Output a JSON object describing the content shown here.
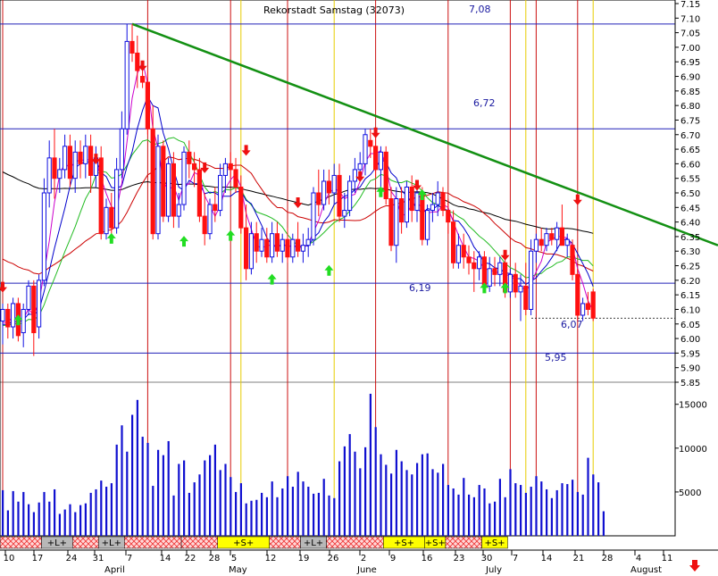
{
  "title_overlay": "Rekorstadt Samstag (32073)",
  "colors": {
    "up": "#1010e0",
    "down": "#ff1010",
    "trend": "#139013",
    "level": "#2020b8",
    "signal_sell": "#cc1010",
    "signal_buy": "#e6cc00",
    "ma_black": "#000000",
    "ma_red": "#cc0000",
    "ma_green": "#22bb22",
    "ma_blue": "#0000cc",
    "ma_magenta": "#cc00cc",
    "buy_arrow": "#22dd22",
    "sell_arrow": "#ee1010",
    "volume": "#1010d0",
    "band_L": "#b8b8b8",
    "band_S": "#ffff00",
    "band_hatch": "#ee3333"
  },
  "chart_data": {
    "type": "candlestick",
    "y_axis": {
      "min": 5.85,
      "max": 7.15,
      "ticks": [
        "7.15",
        "7.10",
        "7.05",
        "7.00",
        "6.95",
        "6.90",
        "6.85",
        "6.80",
        "6.75",
        "6.70",
        "6.65",
        "6.60",
        "6.55",
        "6.50",
        "6.45",
        "6.40",
        "6.35",
        "6.30",
        "6.25",
        "6.20",
        "6.15",
        "6.10",
        "6.05",
        "6.00",
        "5.95",
        "5.90",
        "5.85"
      ]
    },
    "volume_axis": {
      "ticks": [
        "15000",
        "10000",
        "5000"
      ],
      "max": 16500
    },
    "x_ticks": [
      "10",
      "17",
      "24",
      "31",
      "7",
      "14",
      "22",
      "28",
      "5",
      "12",
      "19",
      "26",
      "2",
      "9",
      "16",
      "23",
      "30",
      "7",
      "14",
      "21",
      "28",
      "4",
      "11"
    ],
    "month_labels": [
      "April",
      "May",
      "June",
      "July",
      "August"
    ],
    "levels": [
      {
        "value": 7.08,
        "label": "7,08"
      },
      {
        "value": 6.72,
        "label": "6,72"
      },
      {
        "value": 6.19,
        "label": "6,19"
      },
      {
        "value": 6.07,
        "label": "6,07"
      },
      {
        "value": 5.95,
        "label": "5,95"
      }
    ],
    "trendline": {
      "start": {
        "day": 25,
        "value": 7.08
      },
      "end": {
        "day": 130,
        "value": 6.32
      }
    },
    "sell_signal_days": [
      0,
      28,
      44,
      55,
      72,
      86,
      98,
      103,
      111
    ],
    "buy_signal_days": [
      46,
      64,
      101,
      114
    ],
    "candles": [
      {
        "o": 6.06,
        "h": 6.12,
        "l": 5.98,
        "c": 6.1
      },
      {
        "o": 6.1,
        "h": 6.12,
        "l": 6.0,
        "c": 6.04
      },
      {
        "o": 6.04,
        "h": 6.14,
        "l": 6.0,
        "c": 6.12
      },
      {
        "o": 6.12,
        "h": 6.14,
        "l": 5.99,
        "c": 6.01
      },
      {
        "o": 6.02,
        "h": 6.12,
        "l": 5.97,
        "c": 6.1
      },
      {
        "o": 6.1,
        "h": 6.2,
        "l": 6.08,
        "c": 6.18
      },
      {
        "o": 6.18,
        "h": 6.2,
        "l": 5.94,
        "c": 6.02
      },
      {
        "o": 6.04,
        "h": 6.22,
        "l": 6.0,
        "c": 6.2
      },
      {
        "o": 6.2,
        "h": 6.55,
        "l": 6.18,
        "c": 6.5
      },
      {
        "o": 6.5,
        "h": 6.68,
        "l": 6.45,
        "c": 6.62
      },
      {
        "o": 6.62,
        "h": 6.72,
        "l": 6.48,
        "c": 6.55
      },
      {
        "o": 6.55,
        "h": 6.62,
        "l": 6.5,
        "c": 6.58
      },
      {
        "o": 6.58,
        "h": 6.7,
        "l": 6.55,
        "c": 6.66
      },
      {
        "o": 6.66,
        "h": 6.7,
        "l": 6.52,
        "c": 6.55
      },
      {
        "o": 6.55,
        "h": 6.68,
        "l": 6.5,
        "c": 6.64
      },
      {
        "o": 6.64,
        "h": 6.68,
        "l": 6.55,
        "c": 6.6
      },
      {
        "o": 6.6,
        "h": 6.7,
        "l": 6.55,
        "c": 6.66
      },
      {
        "o": 6.66,
        "h": 6.7,
        "l": 6.5,
        "c": 6.56
      },
      {
        "o": 6.56,
        "h": 6.66,
        "l": 6.52,
        "c": 6.62
      },
      {
        "o": 6.62,
        "h": 6.66,
        "l": 6.34,
        "c": 6.36
      },
      {
        "o": 6.36,
        "h": 6.48,
        "l": 6.34,
        "c": 6.45
      },
      {
        "o": 6.45,
        "h": 6.5,
        "l": 6.36,
        "c": 6.38
      },
      {
        "o": 6.38,
        "h": 6.62,
        "l": 6.36,
        "c": 6.58
      },
      {
        "o": 6.58,
        "h": 6.78,
        "l": 6.55,
        "c": 6.72
      },
      {
        "o": 6.72,
        "h": 7.08,
        "l": 6.7,
        "c": 7.02
      },
      {
        "o": 7.02,
        "h": 7.08,
        "l": 6.95,
        "c": 6.98
      },
      {
        "o": 6.98,
        "h": 7.04,
        "l": 6.86,
        "c": 6.92
      },
      {
        "o": 6.9,
        "h": 6.95,
        "l": 6.86,
        "c": 6.88
      },
      {
        "o": 6.88,
        "h": 6.92,
        "l": 6.7,
        "c": 6.72
      },
      {
        "o": 6.72,
        "h": 6.8,
        "l": 6.34,
        "c": 6.36
      },
      {
        "o": 6.36,
        "h": 6.7,
        "l": 6.34,
        "c": 6.66
      },
      {
        "o": 6.66,
        "h": 6.68,
        "l": 6.4,
        "c": 6.42
      },
      {
        "o": 6.42,
        "h": 6.62,
        "l": 6.4,
        "c": 6.6
      },
      {
        "o": 6.6,
        "h": 6.64,
        "l": 6.38,
        "c": 6.42
      },
      {
        "o": 6.42,
        "h": 6.5,
        "l": 6.38,
        "c": 6.46
      },
      {
        "o": 6.46,
        "h": 6.66,
        "l": 6.44,
        "c": 6.64
      },
      {
        "o": 6.64,
        "h": 6.68,
        "l": 6.55,
        "c": 6.6
      },
      {
        "o": 6.6,
        "h": 6.64,
        "l": 6.52,
        "c": 6.58
      },
      {
        "o": 6.58,
        "h": 6.62,
        "l": 6.4,
        "c": 6.42
      },
      {
        "o": 6.42,
        "h": 6.5,
        "l": 6.32,
        "c": 6.36
      },
      {
        "o": 6.36,
        "h": 6.48,
        "l": 6.34,
        "c": 6.46
      },
      {
        "o": 6.46,
        "h": 6.52,
        "l": 6.4,
        "c": 6.44
      },
      {
        "o": 6.44,
        "h": 6.6,
        "l": 6.42,
        "c": 6.56
      },
      {
        "o": 6.56,
        "h": 6.62,
        "l": 6.5,
        "c": 6.6
      },
      {
        "o": 6.6,
        "h": 6.64,
        "l": 6.55,
        "c": 6.58
      },
      {
        "o": 6.58,
        "h": 6.62,
        "l": 6.5,
        "c": 6.52
      },
      {
        "o": 6.52,
        "h": 6.56,
        "l": 6.36,
        "c": 6.38
      },
      {
        "o": 6.38,
        "h": 6.46,
        "l": 6.2,
        "c": 6.24
      },
      {
        "o": 6.24,
        "h": 6.4,
        "l": 6.22,
        "c": 6.36
      },
      {
        "o": 6.36,
        "h": 6.4,
        "l": 6.26,
        "c": 6.3
      },
      {
        "o": 6.3,
        "h": 6.38,
        "l": 6.28,
        "c": 6.34
      },
      {
        "o": 6.34,
        "h": 6.38,
        "l": 6.26,
        "c": 6.28
      },
      {
        "o": 6.28,
        "h": 6.4,
        "l": 6.26,
        "c": 6.36
      },
      {
        "o": 6.36,
        "h": 6.4,
        "l": 6.28,
        "c": 6.3
      },
      {
        "o": 6.3,
        "h": 6.36,
        "l": 6.26,
        "c": 6.34
      },
      {
        "o": 6.34,
        "h": 6.38,
        "l": 6.26,
        "c": 6.28
      },
      {
        "o": 6.28,
        "h": 6.36,
        "l": 6.26,
        "c": 6.34
      },
      {
        "o": 6.34,
        "h": 6.4,
        "l": 6.28,
        "c": 6.3
      },
      {
        "o": 6.3,
        "h": 6.36,
        "l": 6.26,
        "c": 6.32
      },
      {
        "o": 6.32,
        "h": 6.38,
        "l": 6.28,
        "c": 6.34
      },
      {
        "o": 6.34,
        "h": 6.52,
        "l": 6.32,
        "c": 6.5
      },
      {
        "o": 6.5,
        "h": 6.58,
        "l": 6.42,
        "c": 6.46
      },
      {
        "o": 6.46,
        "h": 6.58,
        "l": 6.44,
        "c": 6.54
      },
      {
        "o": 6.54,
        "h": 6.58,
        "l": 6.46,
        "c": 6.5
      },
      {
        "o": 6.5,
        "h": 6.6,
        "l": 6.46,
        "c": 6.56
      },
      {
        "o": 6.56,
        "h": 6.6,
        "l": 6.4,
        "c": 6.42
      },
      {
        "o": 6.42,
        "h": 6.5,
        "l": 6.38,
        "c": 6.44
      },
      {
        "o": 6.44,
        "h": 6.56,
        "l": 6.42,
        "c": 6.54
      },
      {
        "o": 6.54,
        "h": 6.62,
        "l": 6.5,
        "c": 6.58
      },
      {
        "o": 6.58,
        "h": 6.64,
        "l": 6.54,
        "c": 6.6
      },
      {
        "o": 6.6,
        "h": 6.72,
        "l": 6.56,
        "c": 6.7
      },
      {
        "o": 6.68,
        "h": 6.72,
        "l": 6.62,
        "c": 6.66
      },
      {
        "o": 6.66,
        "h": 6.72,
        "l": 6.55,
        "c": 6.58
      },
      {
        "o": 6.58,
        "h": 6.66,
        "l": 6.5,
        "c": 6.64
      },
      {
        "o": 6.64,
        "h": 6.66,
        "l": 6.46,
        "c": 6.48
      },
      {
        "o": 6.48,
        "h": 6.52,
        "l": 6.3,
        "c": 6.32
      },
      {
        "o": 6.32,
        "h": 6.52,
        "l": 6.26,
        "c": 6.48
      },
      {
        "o": 6.48,
        "h": 6.52,
        "l": 6.36,
        "c": 6.4
      },
      {
        "o": 6.4,
        "h": 6.54,
        "l": 6.38,
        "c": 6.52
      },
      {
        "o": 6.52,
        "h": 6.56,
        "l": 6.4,
        "c": 6.44
      },
      {
        "o": 6.44,
        "h": 6.54,
        "l": 6.4,
        "c": 6.5
      },
      {
        "o": 6.5,
        "h": 6.52,
        "l": 6.32,
        "c": 6.34
      },
      {
        "o": 6.34,
        "h": 6.46,
        "l": 6.32,
        "c": 6.44
      },
      {
        "o": 6.44,
        "h": 6.5,
        "l": 6.4,
        "c": 6.46
      },
      {
        "o": 6.46,
        "h": 6.54,
        "l": 6.42,
        "c": 6.5
      },
      {
        "o": 6.5,
        "h": 6.52,
        "l": 6.42,
        "c": 6.44
      },
      {
        "o": 6.44,
        "h": 6.48,
        "l": 6.36,
        "c": 6.4
      },
      {
        "o": 6.4,
        "h": 6.44,
        "l": 6.24,
        "c": 6.26
      },
      {
        "o": 6.26,
        "h": 6.36,
        "l": 6.24,
        "c": 6.32
      },
      {
        "o": 6.32,
        "h": 6.36,
        "l": 6.24,
        "c": 6.28
      },
      {
        "o": 6.28,
        "h": 6.32,
        "l": 6.22,
        "c": 6.26
      },
      {
        "o": 6.26,
        "h": 6.3,
        "l": 6.16,
        "c": 6.24
      },
      {
        "o": 6.24,
        "h": 6.3,
        "l": 6.2,
        "c": 6.28
      },
      {
        "o": 6.28,
        "h": 6.3,
        "l": 6.16,
        "c": 6.18
      },
      {
        "o": 6.18,
        "h": 6.28,
        "l": 6.16,
        "c": 6.24
      },
      {
        "o": 6.24,
        "h": 6.28,
        "l": 6.18,
        "c": 6.22
      },
      {
        "o": 6.22,
        "h": 6.28,
        "l": 6.18,
        "c": 6.26
      },
      {
        "o": 6.26,
        "h": 6.28,
        "l": 6.14,
        "c": 6.16
      },
      {
        "o": 6.16,
        "h": 6.24,
        "l": 6.14,
        "c": 6.22
      },
      {
        "o": 6.22,
        "h": 6.26,
        "l": 6.14,
        "c": 6.16
      },
      {
        "o": 6.16,
        "h": 6.22,
        "l": 6.06,
        "c": 6.18
      },
      {
        "o": 6.18,
        "h": 6.26,
        "l": 6.08,
        "c": 6.1
      },
      {
        "o": 6.1,
        "h": 6.34,
        "l": 6.08,
        "c": 6.3
      },
      {
        "o": 6.3,
        "h": 6.36,
        "l": 6.26,
        "c": 6.34
      },
      {
        "o": 6.34,
        "h": 6.38,
        "l": 6.3,
        "c": 6.32
      },
      {
        "o": 6.32,
        "h": 6.38,
        "l": 6.3,
        "c": 6.36
      },
      {
        "o": 6.36,
        "h": 6.38,
        "l": 6.32,
        "c": 6.34
      },
      {
        "o": 6.34,
        "h": 6.4,
        "l": 6.3,
        "c": 6.38
      },
      {
        "o": 6.38,
        "h": 6.46,
        "l": 6.34,
        "c": 6.32
      },
      {
        "o": 6.32,
        "h": 6.36,
        "l": 6.28,
        "c": 6.34
      },
      {
        "o": 6.32,
        "h": 6.34,
        "l": 6.2,
        "c": 6.22
      },
      {
        "o": 6.22,
        "h": 6.24,
        "l": 6.06,
        "c": 6.08
      },
      {
        "o": 6.08,
        "h": 6.14,
        "l": 6.06,
        "c": 6.12
      },
      {
        "o": 6.12,
        "h": 6.16,
        "l": 6.08,
        "c": 6.1
      },
      {
        "o": 6.16,
        "h": 6.17,
        "l": 6.06,
        "c": 6.07
      }
    ],
    "volume": [
      5200,
      2900,
      5100,
      3900,
      5000,
      3600,
      2700,
      3800,
      5000,
      3900,
      5300,
      2500,
      3000,
      3600,
      2700,
      3500,
      3700,
      4900,
      5300,
      6300,
      5600,
      6000,
      10400,
      12600,
      9600,
      13800,
      15500,
      11300,
      10600,
      5700,
      9800,
      9200,
      10800,
      4600,
      8200,
      8600,
      4900,
      6100,
      7000,
      8600,
      9200,
      10400,
      7500,
      8200,
      6700,
      5000,
      6000,
      3700,
      4000,
      4100,
      4900,
      4400,
      6200,
      4400,
      5400,
      6800,
      5600,
      7300,
      6200,
      5600,
      4800,
      4900,
      6500,
      4600,
      4300,
      8500,
      10200,
      11600,
      9600,
      7700,
      10100,
      16200,
      12400,
      9300,
      8100,
      7100,
      9800,
      8500,
      7500,
      7000,
      8300,
      9300,
      9400,
      7600,
      7200,
      8200,
      5800,
      5400,
      4700,
      6600,
      4700,
      4400,
      5800,
      5400,
      3700,
      3900,
      6500,
      4400,
      7600,
      6000,
      5800,
      4900,
      5600,
      6800,
      6200,
      5300,
      4300,
      5200,
      6000,
      5900,
      6400,
      5000,
      4700,
      8900,
      7000,
      6100,
      2800
    ],
    "bands": [
      {
        "start": 0,
        "end": 8,
        "type": "hatch",
        "label": ""
      },
      {
        "start": 8,
        "end": 14,
        "type": "L",
        "label": "+L+"
      },
      {
        "start": 14,
        "end": 19,
        "type": "hatch",
        "label": ""
      },
      {
        "start": 19,
        "end": 24,
        "type": "L",
        "label": "+L+"
      },
      {
        "start": 24,
        "end": 35,
        "type": "hatch",
        "label": ""
      },
      {
        "start": 35,
        "end": 42,
        "type": "hatch",
        "label": ""
      },
      {
        "start": 42,
        "end": 52,
        "type": "S",
        "label": "+S+"
      },
      {
        "start": 52,
        "end": 58,
        "type": "hatch",
        "label": ""
      },
      {
        "start": 58,
        "end": 63,
        "type": "L",
        "label": "+L+"
      },
      {
        "start": 63,
        "end": 74,
        "type": "hatch",
        "label": ""
      },
      {
        "start": 74,
        "end": 82,
        "type": "S",
        "label": "+S+"
      },
      {
        "start": 82,
        "end": 86,
        "type": "S",
        "label": "+S+"
      },
      {
        "start": 86,
        "end": 93,
        "type": "hatch",
        "label": ""
      },
      {
        "start": 93,
        "end": 98,
        "type": "S",
        "label": "+S+"
      }
    ]
  }
}
